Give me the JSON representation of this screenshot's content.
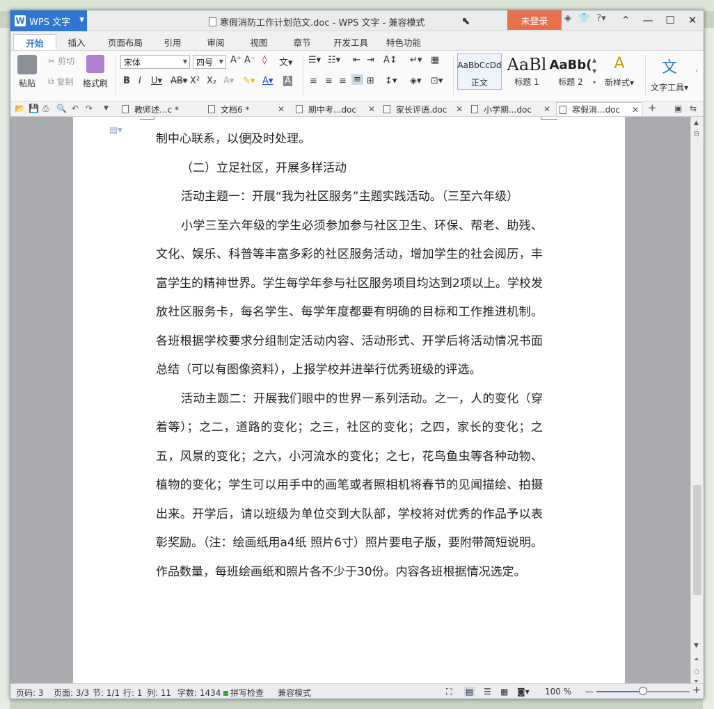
{
  "app": {
    "name": "WPS 文字",
    "title": "寒假消防工作计划范文.doc - WPS 文字 - 兼容模式",
    "login": "未登录"
  },
  "ribbon_tabs": [
    "开始",
    "插入",
    "页面布局",
    "引用",
    "审阅",
    "视图",
    "章节",
    "开发工具",
    "特色功能"
  ],
  "ribbon": {
    "paste": "粘贴",
    "cut": "剪切",
    "copy": "复制",
    "format_painter": "格式刷",
    "font_name": "宋体",
    "font_size": "四号",
    "styles": [
      {
        "sample": "AaBbCcDd",
        "label": "正文"
      },
      {
        "sample": "AaBl",
        "label": "标题 1"
      },
      {
        "sample": "AaBb(",
        "label": "标题 2"
      }
    ],
    "new_style": "新样式",
    "text_tools": "文字工具"
  },
  "doc_tabs": [
    {
      "name": "教师述...c *"
    },
    {
      "name": "文档6 *"
    },
    {
      "name": "期中考...doc"
    },
    {
      "name": "家长评语.doc"
    },
    {
      "name": "小学期...doc"
    },
    {
      "name": "寒假消...doc"
    }
  ],
  "document": {
    "paragraphs": [
      "制中心联系，以便及时处理。",
      "（二）立足社区，开展多样活动",
      "活动主题一：开展“我为社区服务”主题实践活动。（三至六年级）",
      "小学三至六年级的学生必须参加参与社区卫生、环保、帮老、助残、文化、娱乐、科普等丰富多彩的社区服务活动，增加学生的社会阅历，丰富学生的精神世界。学生每学年参与社区服务项目均达到2项以上。学校发放社区服务卡，每名学生、每学年度都要有明确的目标和工作推进机制。各班根据学校要求分组制定活动内容、活动形式、开学后将活动情况书面总结（可以有图像资料），上报学校并进举行优秀班级的评选。",
      "活动主题二：开展我们眼中的世界一系列活动。之一，人的变化（穿着等）；之二，道路的变化；之三，社区的变化；之四，家长的变化；之五，风景的变化；之六，小河流水的变化；之七，花鸟鱼虫等各种动物、植物的变化；学生可以用手中的画笔或者照相机将春节的见闻描绘、拍摄出来。开学后，请以班级为单位交到大队部，学校将对优秀的作品予以表彰奖励。（注：绘画纸用a4纸 照片6寸）照片要电子版，要附带简短说明。作品数量，每班绘画纸和照片各不少于30份。内容各班根据情况选定。"
    ]
  },
  "status": {
    "page_code": "页码: 3",
    "page": "页面: 3/3",
    "section": "节: 1/1",
    "row": "行: 1",
    "col": "列: 11",
    "words": "字数: 1434",
    "spell": "拼写检查",
    "mode": "兼容模式",
    "zoom": "100 %",
    "zoom_fraction": 0.5
  }
}
